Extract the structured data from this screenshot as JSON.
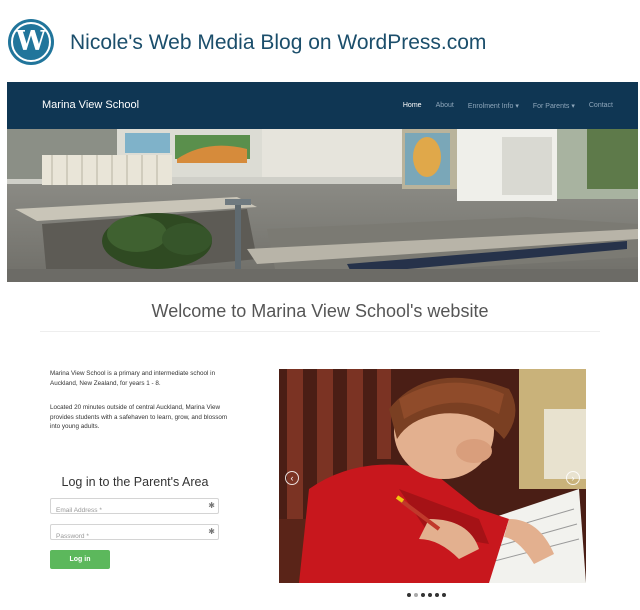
{
  "blog": {
    "title": "Nicole's Web Media Blog on WordPress.com",
    "logo_letter": "W"
  },
  "site": {
    "brand": "Marina View School",
    "nav": [
      {
        "label": "Home",
        "active": true
      },
      {
        "label": "About"
      },
      {
        "label": "Enrolment Info ▾"
      },
      {
        "label": "For Parents ▾"
      },
      {
        "label": "Contact"
      }
    ]
  },
  "welcome": {
    "heading": "Welcome to Marina View School's website"
  },
  "intro": {
    "paragraph1": "Marina View School is a primary and intermediate school in Auckland, New Zealand, for years 1 - 8.",
    "paragraph2": "Located 20 minutes outside of central Auckland, Marina View provides students with a safehaven to learn, grow, and blossom into young adults."
  },
  "login": {
    "title": "Log in to the Parent's Area",
    "email_placeholder": "Email Address *",
    "password_placeholder": "Password *",
    "required_mark": "✱",
    "button_label": "Log in"
  },
  "carousel": {
    "prev_glyph": "‹",
    "next_glyph": "›",
    "slide_count": 6,
    "active_index": 1
  },
  "colors": {
    "navbar": "#0f3653",
    "wp_blue": "#21759b",
    "button_green": "#5cb85c"
  }
}
